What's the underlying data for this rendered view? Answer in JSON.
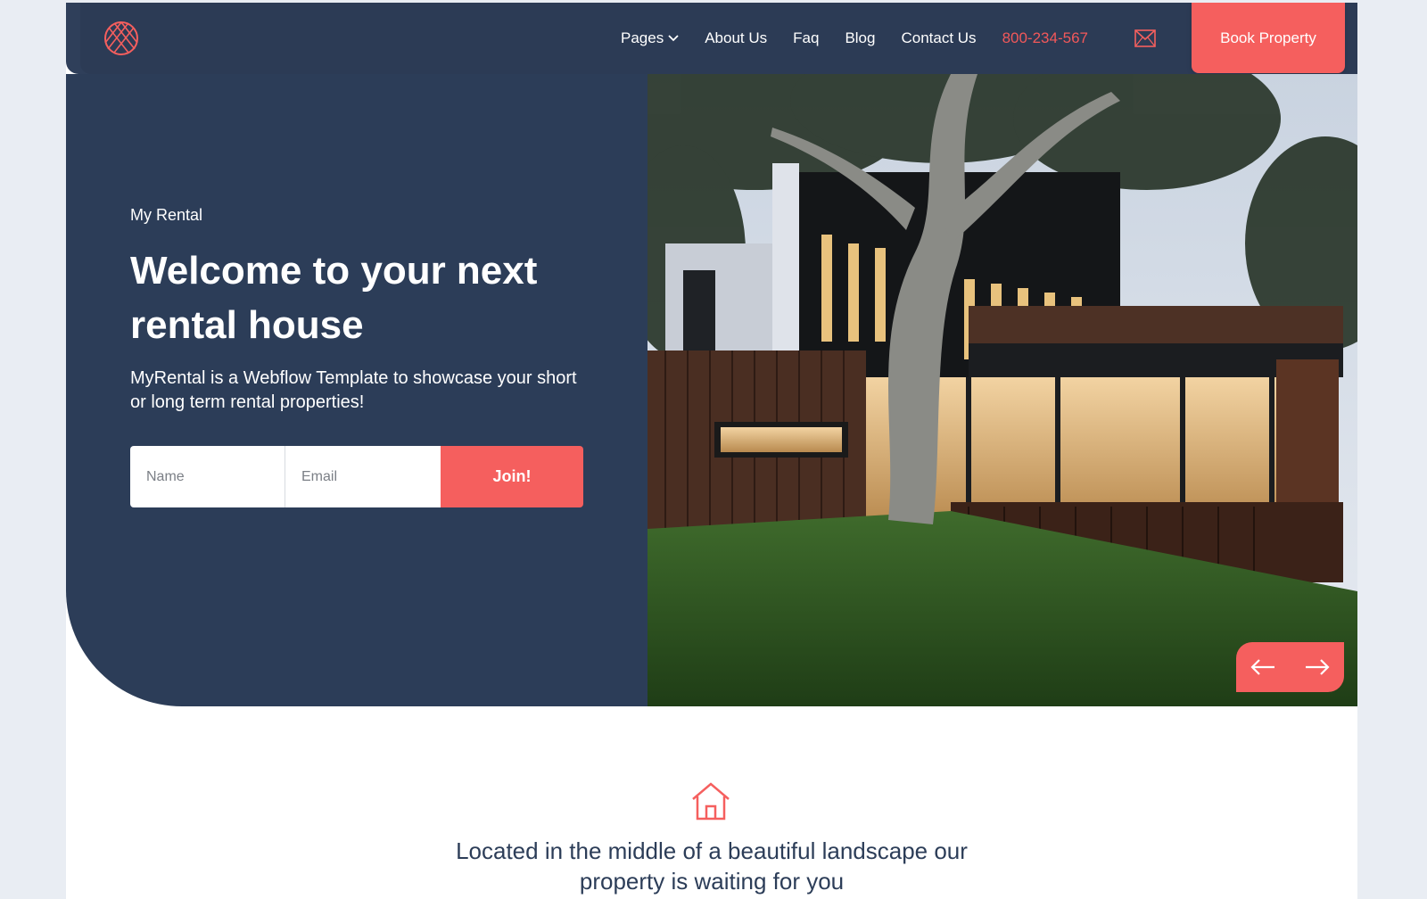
{
  "brand": {
    "accent": "#f55f5e",
    "navy": "#2c3d58"
  },
  "nav": {
    "logo_icon": "lattice-circle-logo",
    "links": [
      "Pages",
      "About Us",
      "Faq",
      "Blog",
      "Contact Us"
    ],
    "phone": "800-234-567",
    "mail_icon": "envelope-icon",
    "book_label": "Book Property"
  },
  "hero": {
    "eyebrow": "My Rental",
    "title": "Welcome to your next rental house",
    "description": "MyRental is a Webflow Template to showcase your short or long term rental properties!",
    "form": {
      "name_placeholder": "Name",
      "email_placeholder": "Email",
      "join_label": "Join!"
    },
    "slider": {
      "prev_icon": "arrow-left-icon",
      "next_icon": "arrow-right-icon"
    }
  },
  "feature": {
    "icon": "house-icon",
    "text": "Located in the middle of a beautiful landscape our property is waiting for you"
  }
}
